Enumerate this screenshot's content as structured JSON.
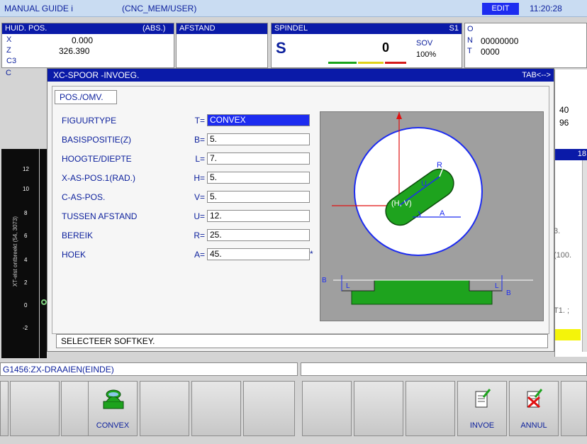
{
  "titlebar": {
    "app": "MANUAL GUIDE i",
    "path": "(CNC_MEM/USER)",
    "mode": "EDIT",
    "time": "11:20:28"
  },
  "pos_panel": {
    "title": "HUID. POS.",
    "coord_mode": "(ABS.)",
    "axes": [
      {
        "name": "X",
        "value": "0.000"
      },
      {
        "name": "Z",
        "value": "326.390"
      },
      {
        "name": "C3",
        "value": ""
      },
      {
        "name": "C",
        "value": ""
      }
    ]
  },
  "dist_panel": {
    "title": "AFSTAND"
  },
  "spindle_panel": {
    "title": "SPINDEL",
    "spindle_id": "S1",
    "s_label": "S",
    "s_value": "0",
    "sov_label": "SOV",
    "sov_value": "100%"
  },
  "prog_panel": {
    "o_label": "O",
    "n_label": "N",
    "n_value": "00000000",
    "t_label": "T",
    "t_value": "0000"
  },
  "right_side": {
    "v1": "40",
    "v2": "96",
    "v3": "18",
    "v4": "3.",
    "v5": "(100.",
    "v6": "T1. ;"
  },
  "graph": {
    "caption": "XT-elst ontbreekt (54, 3073)",
    "yticks": [
      "12",
      "10",
      "8",
      "6",
      "4",
      "2",
      "0",
      "-2"
    ]
  },
  "dialog": {
    "title": "XC-SPOOR -INVOEG.",
    "tab_hint": "TAB<-->",
    "tab_label": "POS./OMV.",
    "fields": [
      {
        "label": "FIGUURTYPE",
        "key": "T=",
        "value": "CONVEX"
      },
      {
        "label": "BASISPOSITIE(Z)",
        "key": "B=",
        "value": "5."
      },
      {
        "label": "HOOGTE/DIEPTE",
        "key": "L=",
        "value": "7."
      },
      {
        "label": "X-AS-POS.1(RAD.)",
        "key": "H=",
        "value": "5."
      },
      {
        "label": "C-AS-POS.",
        "key": "V=",
        "value": "5."
      },
      {
        "label": "TUSSEN AFSTAND",
        "key": "U=",
        "value": "12."
      },
      {
        "label": "BEREIK",
        "key": "R=",
        "value": "25."
      },
      {
        "label": "HOEK",
        "key": "A=",
        "value": "45."
      }
    ],
    "asterisk": "*",
    "message": "SELECTEER SOFTKEY.",
    "figure": {
      "lbl_u": "U",
      "lbl_r": "R",
      "lbl_hv": "(H, V)",
      "lbl_a": "A",
      "lbl_b1": "B",
      "lbl_b2": "B",
      "lbl_l1": "L",
      "lbl_l2": "L"
    }
  },
  "status": {
    "g_line": "G1456:ZX-DRAAIEN(EINDE)"
  },
  "softkeys": [
    {
      "label": ""
    },
    {
      "label": ""
    },
    {
      "label": "CONVEX"
    },
    {
      "label": ""
    },
    {
      "label": ""
    },
    {
      "label": ""
    },
    {
      "label": ""
    },
    {
      "label": ""
    },
    {
      "label": "INVOE"
    },
    {
      "label": "ANNUL"
    },
    {
      "label": ""
    }
  ]
}
